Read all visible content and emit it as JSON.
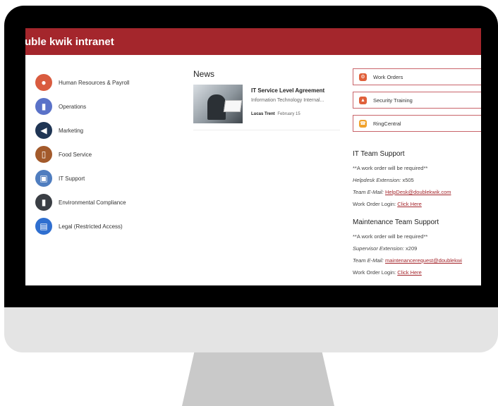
{
  "header": {
    "site_title": "uble kwik intranet",
    "color": "#a4262c"
  },
  "nav": {
    "items": [
      {
        "label": "Human Resources & Payroll",
        "icon": "people-icon",
        "color": "#d95b3f"
      },
      {
        "label": "Operations",
        "icon": "clipboard-icon",
        "color": "#5a72c8"
      },
      {
        "label": "Marketing",
        "icon": "megaphone-icon",
        "color": "#1f3554"
      },
      {
        "label": "Food Service",
        "icon": "cup-icon",
        "color": "#a35a2b"
      },
      {
        "label": "IT Support",
        "icon": "monitor-icon",
        "color": "#4f7dbf"
      },
      {
        "label": "Environmental Compliance",
        "icon": "gas-pump-icon",
        "color": "#3a3e44"
      },
      {
        "label": "Legal (Restricted Access)",
        "icon": "document-icon",
        "color": "#2f6fd0"
      }
    ]
  },
  "news": {
    "title": "News",
    "item": {
      "headline": "IT Service Level Agreement",
      "subtitle": "Information Technology Internal...",
      "author": "Lucas Trent",
      "date": "February 15"
    }
  },
  "quick_links": [
    {
      "label": "Work Orders",
      "icon": "wrench-icon",
      "color": "#e0603a"
    },
    {
      "label": "Security Training",
      "icon": "shield-icon",
      "color": "#e0603a"
    },
    {
      "label": "RingCentral",
      "icon": "phone-icon",
      "color": "#f0a12a"
    }
  ],
  "it_support": {
    "heading": "IT Team Support",
    "note": "**A work order will be required**",
    "ext_label": "Helpdesk Extension:",
    "ext_value": "x505",
    "email_label": "Team E-Mail:",
    "email_value": "HelpDesk@doublekwik.com",
    "login_label": "Work Order Login:",
    "login_link": "Click Here"
  },
  "maintenance_support": {
    "heading": "Maintenance Team Support",
    "note": "**A work order will be required**",
    "ext_label": "Supervisor Extension:",
    "ext_value": "x209",
    "email_label": "Team E-Mail:",
    "email_value": "maintenancerequest@doublekwi",
    "login_label": "Work Order Login:",
    "login_link": "Click Here"
  }
}
